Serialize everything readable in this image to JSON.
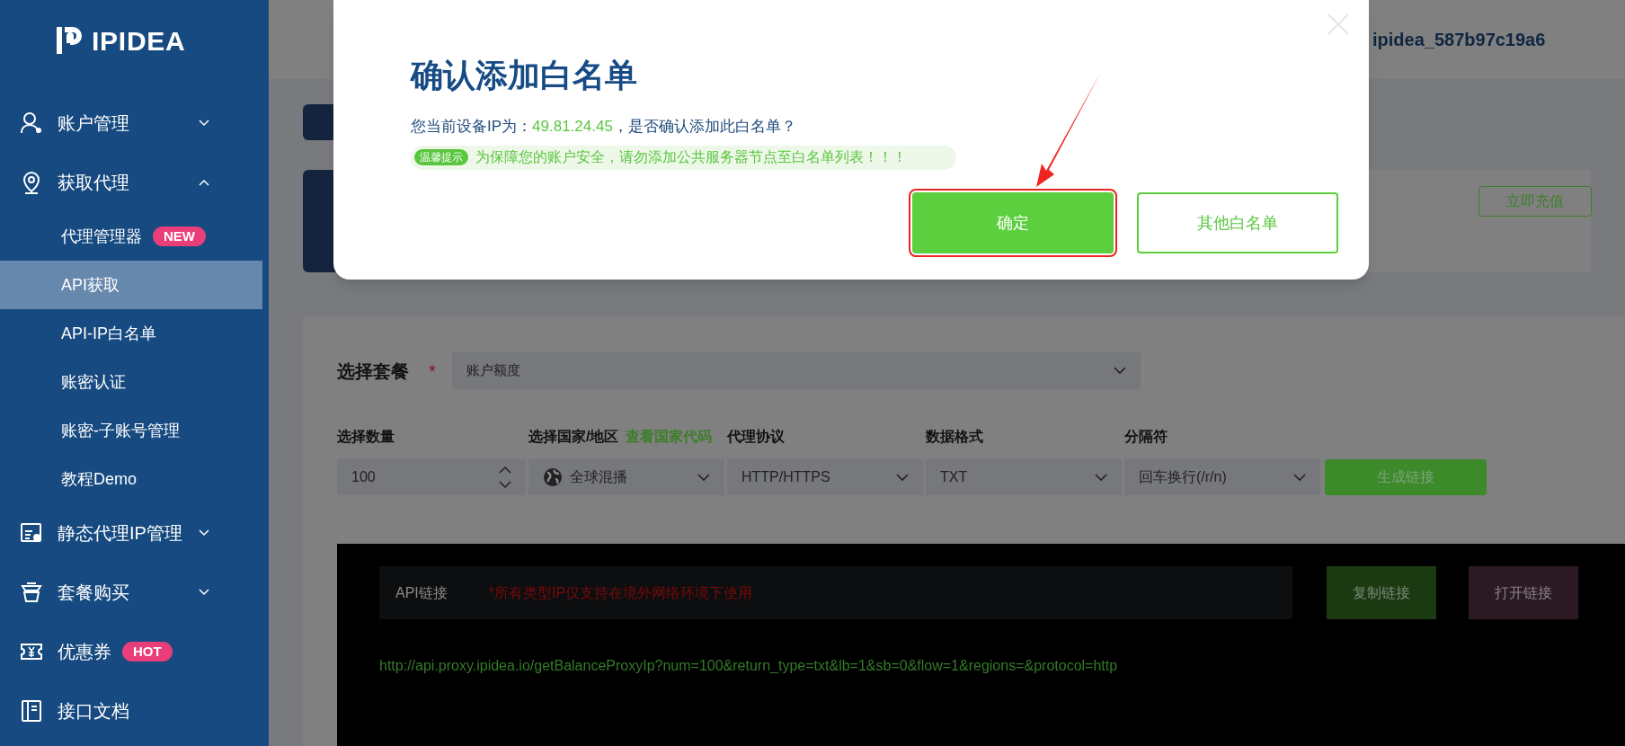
{
  "sidebar": {
    "logo": "IPIDEA",
    "items": [
      {
        "label": "账户管理",
        "expanded": false
      },
      {
        "label": "获取代理",
        "expanded": true,
        "children": [
          {
            "label": "代理管理器",
            "badge": "NEW",
            "selected": false
          },
          {
            "label": "API获取",
            "selected": true
          },
          {
            "label": "API-IP白名单",
            "selected": false
          },
          {
            "label": "账密认证",
            "selected": false
          },
          {
            "label": "账密-子账号管理",
            "selected": false
          },
          {
            "label": "教程Demo",
            "selected": false
          }
        ]
      },
      {
        "label": "静态代理IP管理",
        "expanded": false
      },
      {
        "label": "套餐购买",
        "expanded": false
      },
      {
        "label": "优惠券",
        "badge": "HOT"
      },
      {
        "label": "接口文档"
      }
    ]
  },
  "header": {
    "username": "ipidea_587b97c19a6"
  },
  "recharge_button": "立即充值",
  "package": {
    "label": "选择套餐",
    "required_mark": "*",
    "value": "账户额度"
  },
  "fields": [
    {
      "kind": "number",
      "label": "选择数量",
      "value": "100"
    },
    {
      "kind": "region",
      "label": "选择国家/地区",
      "link": "查看国家代码",
      "value": "全球混播"
    },
    {
      "kind": "select",
      "label": "代理协议",
      "value": "HTTP/HTTPS"
    },
    {
      "kind": "select",
      "label": "数据格式",
      "value": "TXT"
    },
    {
      "kind": "select",
      "label": "分隔符",
      "value": "回车换行(/r/n)"
    }
  ],
  "generate_button": "生成链接",
  "api": {
    "label": "API链接",
    "notice": "*所有类型IP仅支持在境外网络环境下使用",
    "copy_button": "复制链接",
    "open_button": "打开链接",
    "url": "http://api.proxy.ipidea.io/getBalanceProxyIp?num=100&return_type=txt&lb=1&sb=0&flow=1&regions=&protocol=http"
  },
  "modal": {
    "title": "确认添加白名单",
    "message_before": "您当前设备IP为：",
    "ip": "49.81.24.45",
    "message_after": "，是否确认添加此白名单？",
    "tip_badge": "温馨提示",
    "tip": "为保障您的账户安全，请勿添加公共服务器节点至白名单列表！！！",
    "buttons": [
      {
        "label": "确定",
        "kind": "primary",
        "highlighted": true
      },
      {
        "label": "其他白名单",
        "kind": "outline",
        "highlighted": false
      }
    ]
  }
}
